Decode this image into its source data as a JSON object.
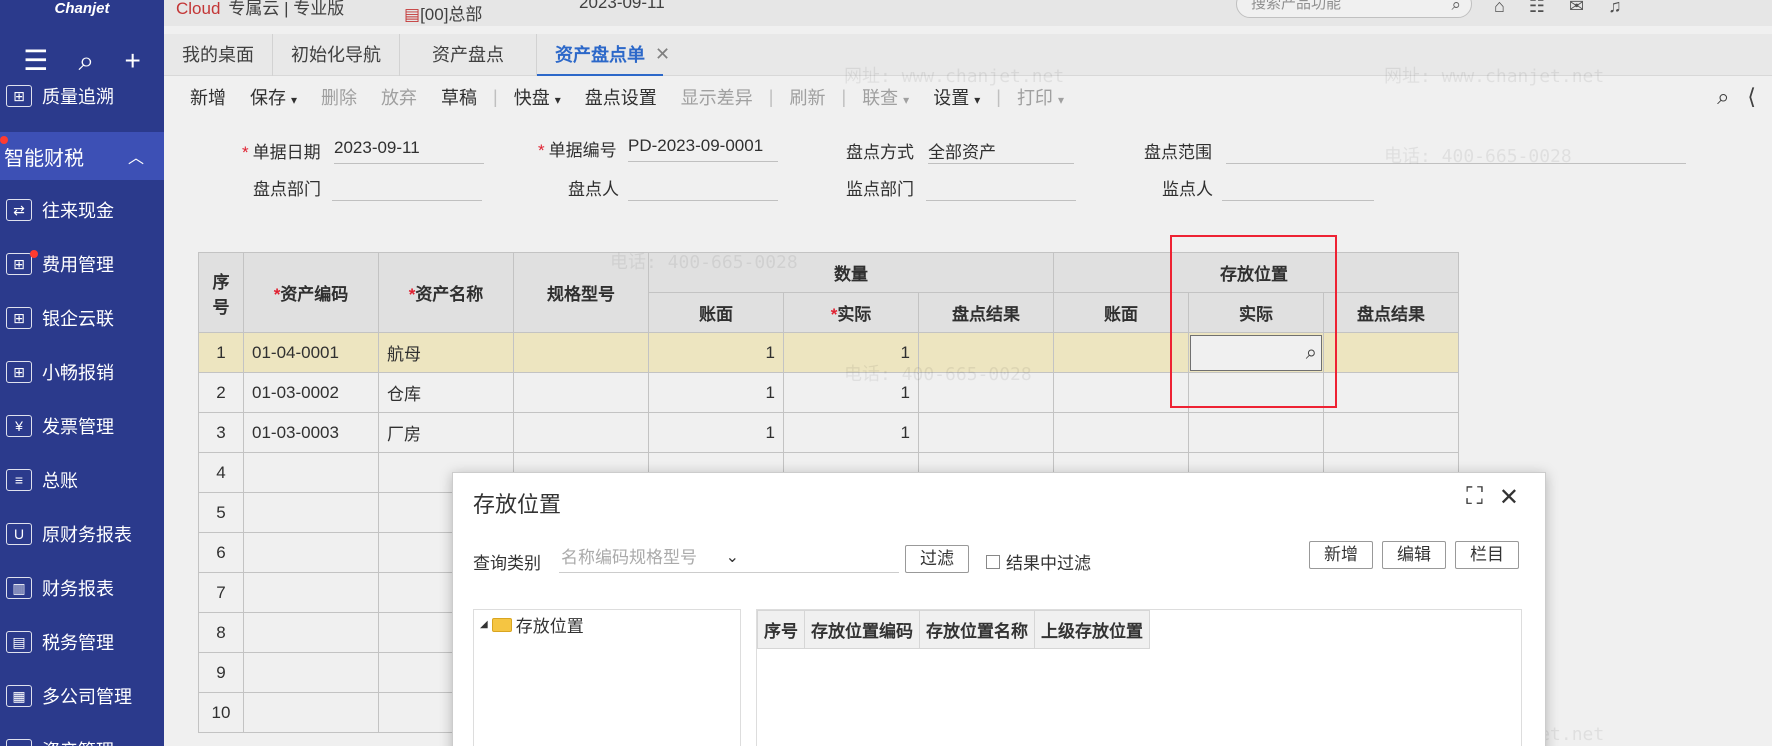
{
  "app": {
    "logo_text": "Chanjet",
    "edition_brand": "Cloud",
    "edition_text": "专属云 | 专业版",
    "org_name": "[00]总部",
    "date": "2023-09-11",
    "search_placeholder": "搜索产品功能"
  },
  "sidebar": {
    "items": [
      {
        "label": "质量追溯"
      },
      {
        "label": "智能财税"
      },
      {
        "label": "往来现金"
      },
      {
        "label": "费用管理"
      },
      {
        "label": "银企云联"
      },
      {
        "label": "小畅报销"
      },
      {
        "label": "发票管理"
      },
      {
        "label": "总账"
      },
      {
        "label": "原财务报表"
      },
      {
        "label": "财务报表"
      },
      {
        "label": "税务管理"
      },
      {
        "label": "多公司管理"
      },
      {
        "label": "资产管理"
      }
    ]
  },
  "tabs": [
    {
      "label": "我的桌面"
    },
    {
      "label": "初始化导航"
    },
    {
      "label": "资产盘点"
    },
    {
      "label": "资产盘点单"
    }
  ],
  "toolbar": {
    "new": "新增",
    "save": "保存",
    "delete": "删除",
    "discard": "放弃",
    "draft": "草稿",
    "quick": "快盘",
    "count_settings": "盘点设置",
    "show_diff": "显示差异",
    "refresh": "刷新",
    "linked": "联查",
    "settings": "设置",
    "print": "打印"
  },
  "form": {
    "doc_date_label": "单据日期",
    "doc_date": "2023-09-11",
    "doc_no_label": "单据编号",
    "doc_no": "PD-2023-09-0001",
    "method_label": "盘点方式",
    "method": "全部资产",
    "range_label": "盘点范围",
    "dept_label": "盘点部门",
    "person_label": "盘点人",
    "supervise_dept_label": "监点部门",
    "supervisor_label": "监点人"
  },
  "grid": {
    "headers": {
      "seq": "序号",
      "code": "资产编码",
      "name": "资产名称",
      "spec": "规格型号",
      "qty_group": "数量",
      "loc_group": "存放位置",
      "book": "账面",
      "actual": "实际",
      "result": "盘点结果"
    },
    "rows": [
      {
        "seq": "1",
        "code": "01-04-0001",
        "name": "航母",
        "qty_book": "1",
        "qty_actual": "1"
      },
      {
        "seq": "2",
        "code": "01-03-0002",
        "name": "仓库",
        "qty_book": "1",
        "qty_actual": "1"
      },
      {
        "seq": "3",
        "code": "01-03-0003",
        "name": "厂房",
        "qty_book": "1",
        "qty_actual": "1"
      },
      {
        "seq": "4"
      },
      {
        "seq": "5"
      },
      {
        "seq": "6"
      },
      {
        "seq": "7"
      },
      {
        "seq": "8"
      },
      {
        "seq": "9"
      },
      {
        "seq": "10"
      }
    ]
  },
  "dialog": {
    "title": "存放位置",
    "query_label": "查询类别",
    "query_placeholder": "名称编码规格型号",
    "filter_button": "过滤",
    "filter_in_results": "结果中过滤",
    "new_button": "新增",
    "edit_button": "编辑",
    "columns_button": "栏目",
    "tree_root": "存放位置",
    "list_headers": [
      "序号",
      "存放位置编码",
      "存放位置名称",
      "上级存放位置"
    ]
  },
  "watermark": {
    "phone": "电话: 400-665-0028",
    "site": "网址: www.chanjet.net"
  }
}
